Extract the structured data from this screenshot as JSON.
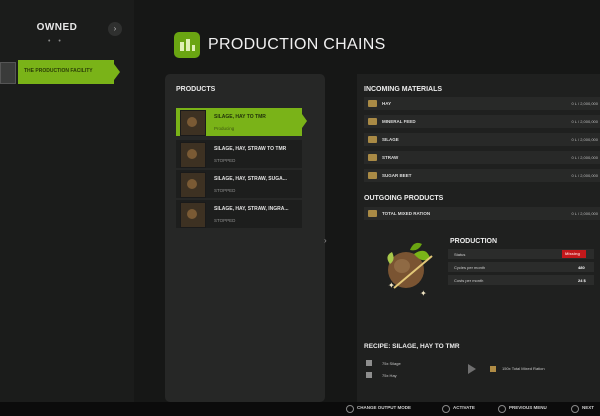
{
  "sidebar": {
    "title": "OWNED",
    "next_glyph": "›",
    "dots": "• •",
    "selected_item": "THE PRODUCTION FACILITY"
  },
  "header": {
    "title": "PRODUCTION CHAINS"
  },
  "products": {
    "title": "PRODUCTS",
    "items": [
      {
        "name": "SILAGE, HAY TO TMR",
        "status": "Producing"
      },
      {
        "name": "SILAGE, HAY, STRAW TO TMR",
        "status": "STOPPED"
      },
      {
        "name": "SILAGE, HAY, STRAW, SUGA...",
        "status": "STOPPED"
      },
      {
        "name": "SILAGE, HAY, STRAW, INGRA...",
        "status": "STOPPED"
      }
    ]
  },
  "incoming": {
    "title": "INCOMING MATERIALS",
    "items": [
      {
        "name": "HAY",
        "qty": "0 L / 2,000,000"
      },
      {
        "name": "MINERAL FEED",
        "qty": "0 L / 2,000,000"
      },
      {
        "name": "SILAGE",
        "qty": "0 L / 2,000,000"
      },
      {
        "name": "STRAW",
        "qty": "0 L / 2,000,000"
      },
      {
        "name": "SUGAR BEET",
        "qty": "0 L / 2,000,000"
      }
    ]
  },
  "outgoing": {
    "title": "OUTGOING PRODUCTS",
    "items": [
      {
        "name": "TOTAL MIXED RATION",
        "qty": "0 L / 2,000,000"
      }
    ]
  },
  "production": {
    "title": "PRODUCTION",
    "rows": [
      {
        "label": "Status",
        "value": "Missing"
      },
      {
        "label": "Cycles per month",
        "value": "480"
      },
      {
        "label": "Costs per month",
        "value": "24 $"
      }
    ]
  },
  "recipe": {
    "title": "RECIPE: SILAGE, HAY TO TMR",
    "inputs": [
      "75x Silage",
      "75x Hay"
    ],
    "output": "150x Total Mixed Ration"
  },
  "bottom_bar": [
    {
      "label": "CHANGE OUTPUT MODE"
    },
    {
      "label": "ACTIVATE"
    },
    {
      "label": "PREVIOUS MENU"
    },
    {
      "label": "NEXT"
    }
  ],
  "colors": {
    "accent": "#7ab318",
    "status_missing": "#c2181b"
  }
}
